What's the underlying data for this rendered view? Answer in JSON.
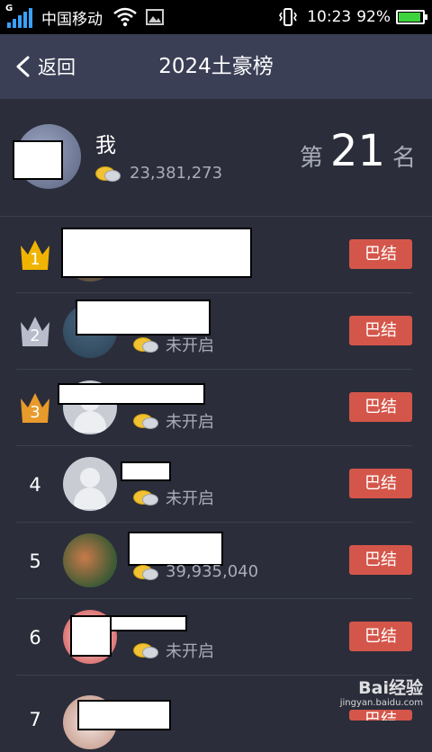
{
  "status": {
    "network_badge": "G",
    "carrier": "中国移动",
    "time": "10:23",
    "battery_percent": "92%",
    "battery_level": 0.92
  },
  "nav": {
    "back_label": "返回",
    "title": "2024土豪榜"
  },
  "me": {
    "name": "我",
    "coins": "23,381,273",
    "rank_prefix": "第",
    "rank": "21",
    "rank_suffix": "名"
  },
  "colors": {
    "background": "#2b2d3a",
    "navbar": "#3a3f56",
    "button": "#d4564a",
    "gold_crown": "#f0b400",
    "silver_crown": "#b8bccb",
    "bronze_crown": "#e89a2a"
  },
  "rows": [
    {
      "rank": "1",
      "crown": "gold",
      "coins": "",
      "button": "巴结",
      "avatar": "photo"
    },
    {
      "rank": "2",
      "crown": "silver",
      "coins": "未开启",
      "button": "巴结",
      "avatar": "photo"
    },
    {
      "rank": "3",
      "crown": "bronze",
      "coins": "未开启",
      "button": "巴结",
      "avatar": "default"
    },
    {
      "rank": "4",
      "crown": "",
      "coins": "未开启",
      "button": "巴结",
      "avatar": "default"
    },
    {
      "rank": "5",
      "crown": "",
      "coins": "39,935,040",
      "button": "巴结",
      "avatar": "photo"
    },
    {
      "rank": "6",
      "crown": "",
      "coins": "未开启",
      "button": "巴结",
      "avatar": "photo"
    },
    {
      "rank": "7",
      "crown": "",
      "coins": "",
      "button": "巴结",
      "avatar": "photo"
    }
  ],
  "watermark": {
    "brand": "Bai经验",
    "url": "jingyan.baidu.com"
  }
}
